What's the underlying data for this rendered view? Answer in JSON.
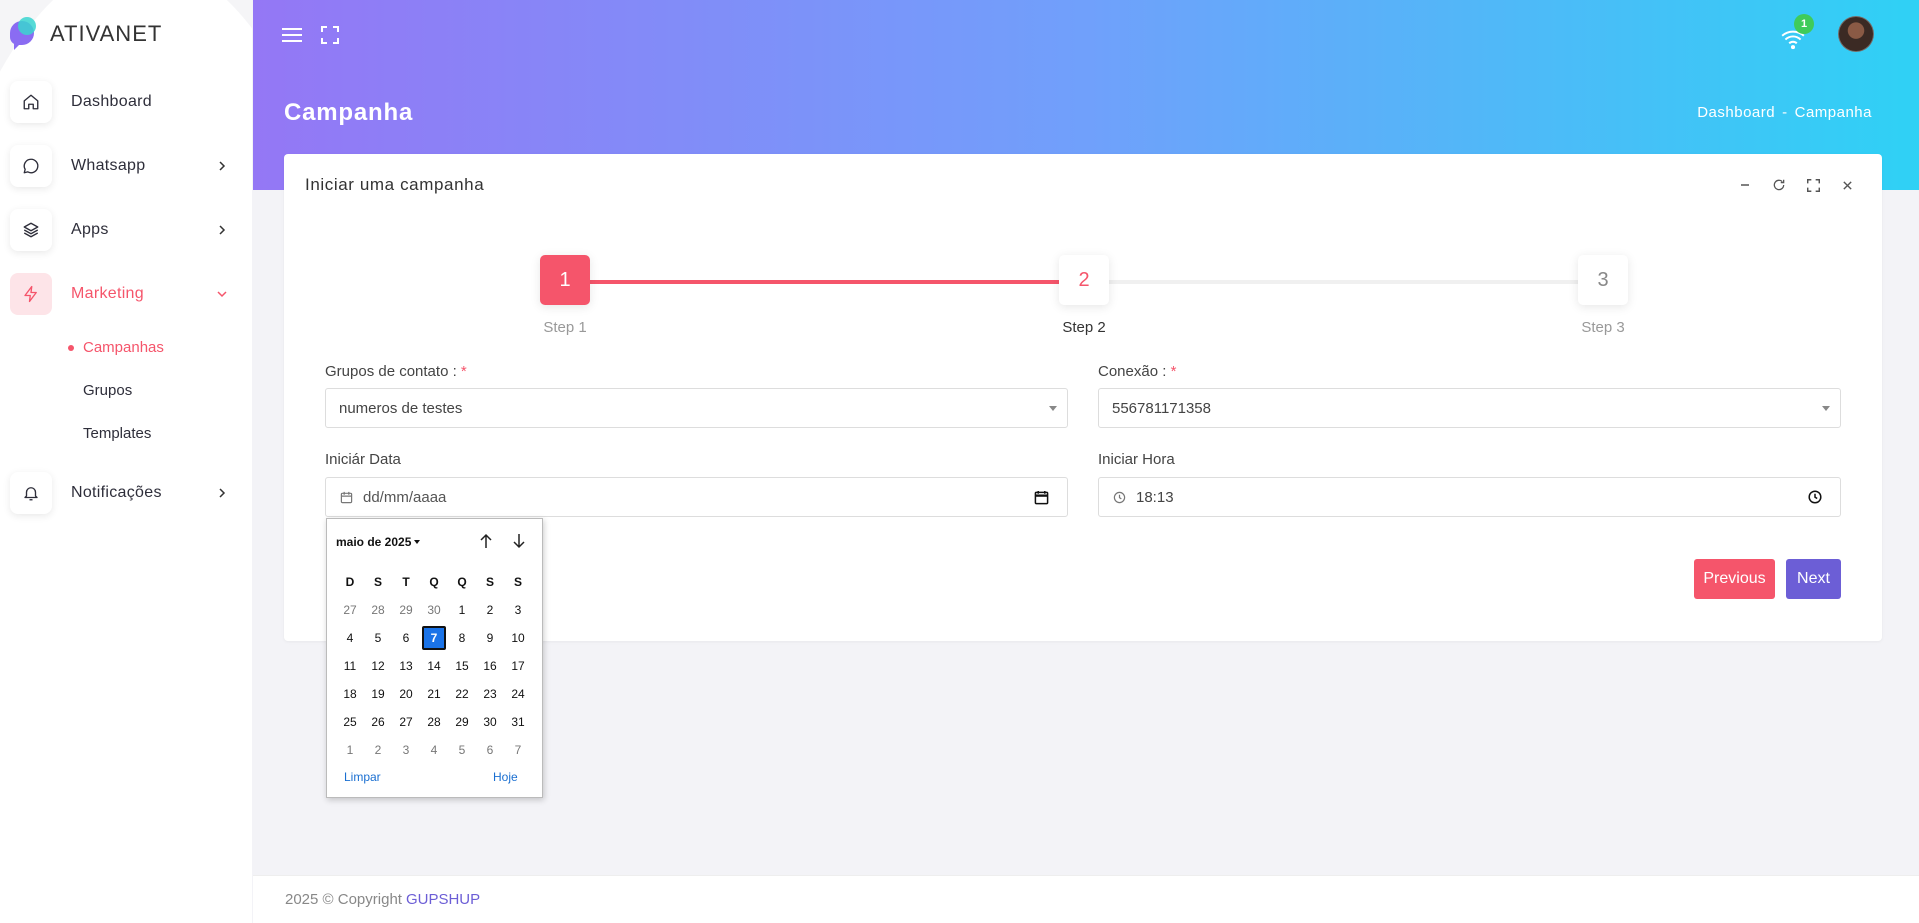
{
  "brand": {
    "name": "ATIVANET"
  },
  "sidebar": {
    "items": [
      {
        "label": "Dashboard",
        "icon": "home-icon"
      },
      {
        "label": "Whatsapp",
        "icon": "chat-icon"
      },
      {
        "label": "Apps",
        "icon": "layers-icon"
      },
      {
        "label": "Marketing",
        "icon": "lightning-icon"
      },
      {
        "label": "Notificações",
        "icon": "bell-icon"
      }
    ],
    "submenu": [
      "Campanhas",
      "Grupos",
      "Templates"
    ]
  },
  "header": {
    "notification_count": "1",
    "page_title": "Campanha",
    "breadcrumb": [
      "Dashboard",
      "-",
      "Campanha"
    ]
  },
  "card": {
    "title": "Iniciar uma campanha",
    "steps": [
      {
        "number": "1",
        "label": "Step 1"
      },
      {
        "number": "2",
        "label": "Step 2"
      },
      {
        "number": "3",
        "label": "Step 3"
      }
    ],
    "form": {
      "grupos_label": "Grupos de contato :",
      "grupos_value": "numeros de testes",
      "conexao_label": "Conexão :",
      "conexao_value": "556781171358",
      "required_mark": "*",
      "data_label": "Iniciár Data",
      "data_placeholder": "dd/mm/aaaa",
      "hora_label": "Iniciar Hora",
      "hora_value": "18:13"
    },
    "buttons": {
      "previous": "Previous",
      "next": "Next"
    }
  },
  "calendar": {
    "month_label": "maio de 2025",
    "weekdays": [
      "D",
      "S",
      "T",
      "Q",
      "Q",
      "S",
      "S"
    ],
    "days": [
      [
        "27",
        "28",
        "29",
        "30",
        "1",
        "2",
        "3"
      ],
      [
        "4",
        "5",
        "6",
        "7",
        "8",
        "9",
        "10"
      ],
      [
        "11",
        "12",
        "13",
        "14",
        "15",
        "16",
        "17"
      ],
      [
        "18",
        "19",
        "20",
        "21",
        "22",
        "23",
        "24"
      ],
      [
        "25",
        "26",
        "27",
        "28",
        "29",
        "30",
        "31"
      ],
      [
        "1",
        "2",
        "3",
        "4",
        "5",
        "6",
        "7"
      ]
    ],
    "selected": "7",
    "clear_label": "Limpar",
    "today_label": "Hoje"
  },
  "footer": {
    "copyright": "2025 © Copyright",
    "brand_link": "GUPSHUP"
  },
  "colors": {
    "accent": "#f5556b",
    "next_button": "#6c5ed6",
    "selected_day": "#1a73e8"
  }
}
